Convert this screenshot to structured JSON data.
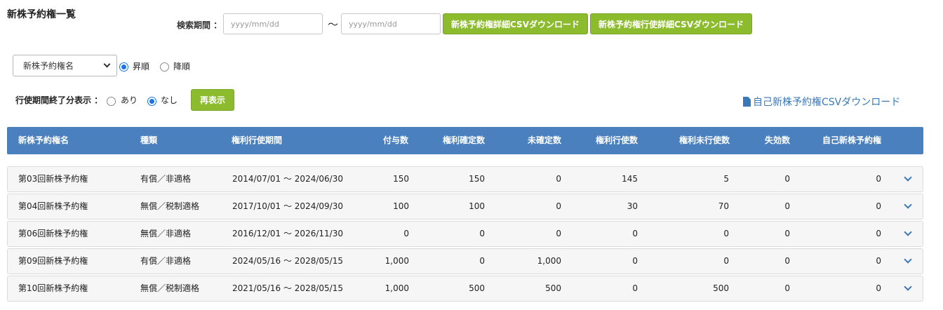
{
  "page": {
    "title": "新株予約権一覧"
  },
  "search": {
    "label": "検索期間 ：",
    "from_placeholder": "yyyy/mm/dd",
    "to_placeholder": "yyyy/mm/dd",
    "tilde": "～",
    "detail_csv_button": "新株予約権詳細CSVダウンロード",
    "exercise_csv_button": "新株予約権行使詳細CSVダウンロード"
  },
  "sort": {
    "selected": "新株予約権名",
    "asc_label": "昇順",
    "desc_label": "降順",
    "order": "asc"
  },
  "filter": {
    "label": "行使期間終了分表示 ：",
    "yes_label": "あり",
    "no_label": "なし",
    "selected": "no",
    "refresh_button": "再表示"
  },
  "self_csv_link": "自己新株予約権CSVダウンロード",
  "table": {
    "headers": [
      "新株予約権名",
      "種類",
      "権利行使期間",
      "付与数",
      "権利確定数",
      "未確定数",
      "権利行使数",
      "権利未行使数",
      "失効数",
      "自己新株予約権"
    ],
    "rows": [
      {
        "name": "第03回新株予約権",
        "type": "有償／非適格",
        "period": "2014/07/01 ～ 2024/06/30",
        "granted": "150",
        "vested": "150",
        "unvested": "0",
        "exercised": "145",
        "unexercised": "5",
        "forfeited": "0",
        "treasury": "0"
      },
      {
        "name": "第04回新株予約権",
        "type": "無償／税制適格",
        "period": "2017/10/01 ～ 2024/09/30",
        "granted": "100",
        "vested": "100",
        "unvested": "0",
        "exercised": "30",
        "unexercised": "70",
        "forfeited": "0",
        "treasury": "0"
      },
      {
        "name": "第06回新株予約権",
        "type": "無償／非適格",
        "period": "2016/12/01 ～ 2026/11/30",
        "granted": "0",
        "vested": "0",
        "unvested": "0",
        "exercised": "0",
        "unexercised": "0",
        "forfeited": "0",
        "treasury": "0"
      },
      {
        "name": "第09回新株予約権",
        "type": "有償／非適格",
        "period": "2024/05/16 ～ 2028/05/15",
        "granted": "1,000",
        "vested": "0",
        "unvested": "1,000",
        "exercised": "0",
        "unexercised": "0",
        "forfeited": "0",
        "treasury": "0"
      },
      {
        "name": "第10回新株予約権",
        "type": "無償／税制適格",
        "period": "2021/05/16 ～ 2028/05/15",
        "granted": "1,000",
        "vested": "500",
        "unvested": "500",
        "exercised": "0",
        "unexercised": "500",
        "forfeited": "0",
        "treasury": "0"
      }
    ]
  },
  "colors": {
    "header_bg": "#4b80be",
    "button_green": "#8dbb2e",
    "link_blue": "#3a78b8",
    "radio_blue": "#1a73e8"
  },
  "icons": {
    "download_file": "file-icon",
    "row_expand": "chevron-down-icon",
    "select_arrow": "chevron-down-icon"
  }
}
